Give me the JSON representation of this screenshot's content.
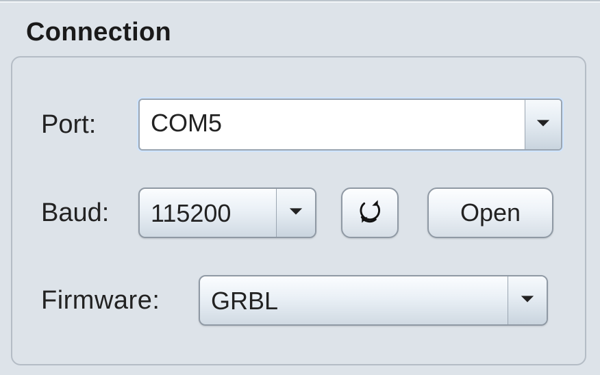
{
  "section": {
    "title": "Connection"
  },
  "labels": {
    "port": "Port:",
    "baud": "Baud:",
    "firmware": "Firmware:"
  },
  "port": {
    "value": "COM5"
  },
  "baud": {
    "value": "115200"
  },
  "firmware": {
    "value": "GRBL"
  },
  "buttons": {
    "open": "Open"
  },
  "icons": {
    "refresh": "refresh-icon",
    "chevron": "chevron-down-icon"
  }
}
